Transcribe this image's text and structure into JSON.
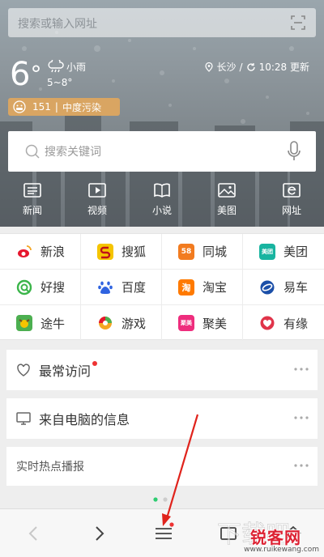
{
  "top_search": {
    "placeholder": "搜索或输入网址"
  },
  "weather": {
    "temp": "6",
    "deg": "°",
    "condition": "小雨",
    "range": "5~8°",
    "city": "长沙",
    "sep": "/",
    "update": "10:28 更新",
    "aqi_value": "151",
    "aqi_sep": "|",
    "aqi_text": "中度污染"
  },
  "search": {
    "placeholder": "搜索关键词"
  },
  "quick_links": [
    {
      "label": "新闻",
      "icon": "news-icon"
    },
    {
      "label": "视频",
      "icon": "video-icon"
    },
    {
      "label": "小说",
      "icon": "book-icon"
    },
    {
      "label": "美图",
      "icon": "picture-icon"
    },
    {
      "label": "网址",
      "icon": "web-icon"
    }
  ],
  "sites": [
    [
      {
        "label": "新浪",
        "icon": "sina-icon",
        "color": "#e6162d",
        "mark": ""
      },
      {
        "label": "搜狐",
        "icon": "sohu-icon",
        "color": "#f5c400",
        "mark": ""
      },
      {
        "label": "同城",
        "icon": "58-icon",
        "color": "#f27b1f",
        "mark": "58"
      },
      {
        "label": "美团",
        "icon": "meituan-icon",
        "color": "#18b4a0",
        "mark": "美团"
      }
    ],
    [
      {
        "label": "好搜",
        "icon": "haosou-icon",
        "color": "#3bb54a",
        "mark": ""
      },
      {
        "label": "百度",
        "icon": "baidu-icon",
        "color": "#2f63e0",
        "mark": ""
      },
      {
        "label": "淘宝",
        "icon": "taobao-icon",
        "color": "#ff7a00",
        "mark": "淘"
      },
      {
        "label": "易车",
        "icon": "yiche-icon",
        "color": "#1b4fa8",
        "mark": ""
      }
    ],
    [
      {
        "label": "途牛",
        "icon": "tuniu-icon",
        "color": "#4caf50",
        "mark": ""
      },
      {
        "label": "游戏",
        "icon": "game-icon",
        "color": "#f5a623",
        "mark": ""
      },
      {
        "label": "聚美",
        "icon": "jumei-icon",
        "color": "#ee2d7d",
        "mark": "聚美"
      },
      {
        "label": "有缘",
        "icon": "youyuan-icon",
        "color": "#e0344a",
        "mark": ""
      }
    ]
  ],
  "cards": {
    "frequent": "最常访问",
    "pc_messages": "来自电脑的信息",
    "hot": "实时热点播报"
  },
  "watermark": {
    "title": "锐客网",
    "url": "www.ruikewang.com"
  },
  "colors": {
    "accent_red": "#e33",
    "pager_active": "#2ecc71"
  }
}
